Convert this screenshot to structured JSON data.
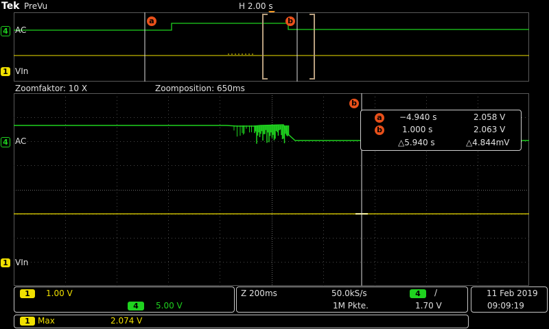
{
  "top_bar": {
    "brand": "Tek",
    "mode": "PreVu",
    "horizontal": "H 2.00 s"
  },
  "preview": {
    "ch4_number": "4",
    "ch4_label": "AC",
    "ch1_number": "1",
    "ch1_label": "VIn",
    "cursor_a": "a",
    "cursor_b": "b"
  },
  "zoom_bar": {
    "factor": "Zoomfaktor: 10 X",
    "position": "Zoomposition: 650ms"
  },
  "main": {
    "ch4_number": "4",
    "ch4_label": "AC",
    "ch1_number": "1",
    "ch1_label": "VIn",
    "cursor_b": "b"
  },
  "cursor_readout": {
    "a_tag": "a",
    "a_time": "−4.940 s",
    "a_volt": "2.058 V",
    "b_tag": "b",
    "b_time": "1.000 s",
    "b_volt": "2.063 V",
    "delta_time": "△5.940 s",
    "delta_volt": "△4.844mV"
  },
  "channels_panel": {
    "ch1_number": "1",
    "ch1_scale": "1.00 V",
    "ch4_number": "4",
    "ch4_scale": "5.00 V"
  },
  "timebase_panel": {
    "zoom": "Z 200ms",
    "sample_rate": "50.0kS/s",
    "record_length": "1M Pkte.",
    "trig_channel": "4",
    "trig_slope": "/",
    "trig_level": "1.70 V"
  },
  "datetime": {
    "date": "11 Feb  2019",
    "time": "09:09:19"
  },
  "measurement": {
    "channel": "1",
    "label": "Max",
    "value": "2.074 V"
  },
  "colors": {
    "ch1": "#f0e000",
    "ch4": "#1fd21f",
    "cursor": "#e8501a",
    "trigger": "#f59a23"
  }
}
